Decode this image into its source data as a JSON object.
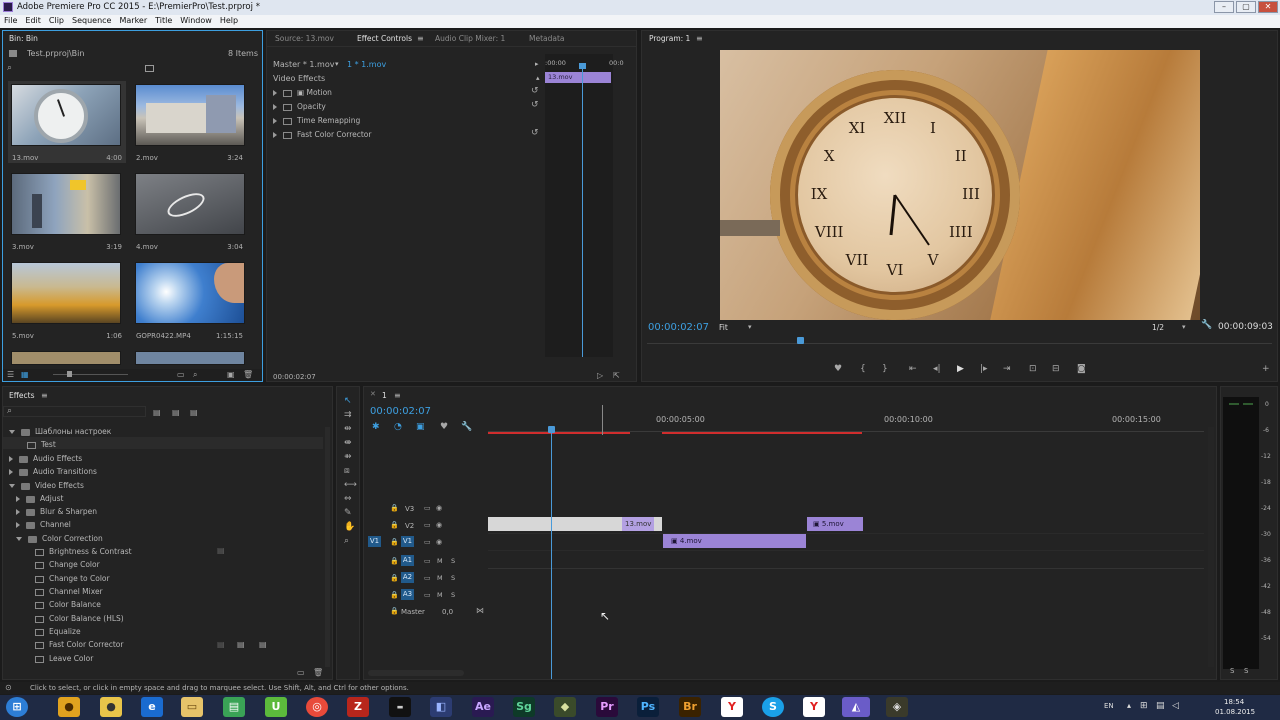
{
  "window": {
    "title": "Adobe Premiere Pro CC 2015 - E:\\PremierPro\\Test.prproj *"
  },
  "menu": [
    "File",
    "Edit",
    "Clip",
    "Sequence",
    "Marker",
    "Title",
    "Window",
    "Help"
  ],
  "bin": {
    "tab": "Bin: Bin",
    "project": "Test.prproj\\Bin",
    "count": "8 Items",
    "items": [
      {
        "name": "13.mov",
        "dur": "4:00"
      },
      {
        "name": "2.mov",
        "dur": "3:24"
      },
      {
        "name": "3.mov",
        "dur": "3:19"
      },
      {
        "name": "4.mov",
        "dur": "3:04"
      },
      {
        "name": "5.mov",
        "dur": "1:06"
      },
      {
        "name": "GOPR0422.MP4",
        "dur": "1:15:15"
      }
    ]
  },
  "source": {
    "tabs": [
      "Source: 13.mov",
      "Effect Controls",
      "Audio Clip Mixer: 1",
      "Metadata"
    ],
    "master": "Master * 1.mov",
    "clip": "1 * 1.mov",
    "section": "Video Effects",
    "effects": [
      "Motion",
      "Opacity",
      "Time Remapping",
      "Fast Color Corrector"
    ],
    "ruler_start": ":00:00",
    "ruler_end": "00:0",
    "clip_label": "13.mov",
    "timecode": "00:00:02:07"
  },
  "program": {
    "tab": "Program: 1",
    "timecode": "00:00:02:07",
    "fit": "Fit",
    "resolution": "1/2",
    "duration": "00:00:09:03",
    "clock_numerals": [
      "XII",
      "I",
      "II",
      "III",
      "IIII",
      "V",
      "VI",
      "VII",
      "VIII",
      "IX",
      "X",
      "XI"
    ]
  },
  "effects_panel": {
    "tab": "Effects",
    "items": [
      {
        "label": "Шаблоны настроек",
        "level": 1,
        "open": true
      },
      {
        "label": "Test",
        "level": 2,
        "type": "preset"
      },
      {
        "label": "Audio Effects",
        "level": 1,
        "open": false
      },
      {
        "label": "Audio Transitions",
        "level": 1,
        "open": false
      },
      {
        "label": "Video Effects",
        "level": 1,
        "open": true
      },
      {
        "label": "Adjust",
        "level": 2,
        "open": false
      },
      {
        "label": "Blur & Sharpen",
        "level": 2,
        "open": false
      },
      {
        "label": "Channel",
        "level": 2,
        "open": false
      },
      {
        "label": "Color Correction",
        "level": 2,
        "open": true
      },
      {
        "label": "Brightness & Contrast",
        "level": 3
      },
      {
        "label": "Change Color",
        "level": 3
      },
      {
        "label": "Change to Color",
        "level": 3
      },
      {
        "label": "Channel Mixer",
        "level": 3
      },
      {
        "label": "Color Balance",
        "level": 3
      },
      {
        "label": "Color Balance (HLS)",
        "level": 3
      },
      {
        "label": "Equalize",
        "level": 3
      },
      {
        "label": "Fast Color Corrector",
        "level": 3
      },
      {
        "label": "Leave Color",
        "level": 3
      }
    ]
  },
  "timeline": {
    "tab": "1",
    "timecode": "00:00:02:07",
    "ruler": [
      "00:00:05:00",
      "00:00:10:00",
      "00:00:15:00"
    ],
    "tracks": [
      "V3",
      "V2",
      "V1",
      "A1",
      "A2",
      "A3"
    ],
    "source_patch": "V1",
    "master_label": "Master",
    "master_value": "0,0",
    "clips": [
      {
        "label": "13.mov",
        "track": "V2"
      },
      {
        "label": "4.mov",
        "track": "V1"
      },
      {
        "label": "5.mov",
        "track": "V2"
      }
    ]
  },
  "meter": {
    "scale": [
      "0",
      "-6",
      "-12",
      "-18",
      "-24",
      "-30",
      "-36",
      "-42",
      "-48",
      "-54"
    ],
    "solo": [
      "S",
      "S"
    ]
  },
  "status": "Click to select, or click in empty space and drag to marquee select. Use Shift, Alt, and Ctrl for other options.",
  "taskbar": {
    "apps": [
      "Ae",
      "Sg",
      "Pr",
      "Ps",
      "Br"
    ],
    "lang": "EN",
    "time": "18:54",
    "date": "01.08.2015"
  },
  "colors": {
    "accent": "#3d9fe0",
    "clip": "#9b84d6",
    "playhead": "#4a9ad8",
    "inout": "#d02d2d"
  }
}
